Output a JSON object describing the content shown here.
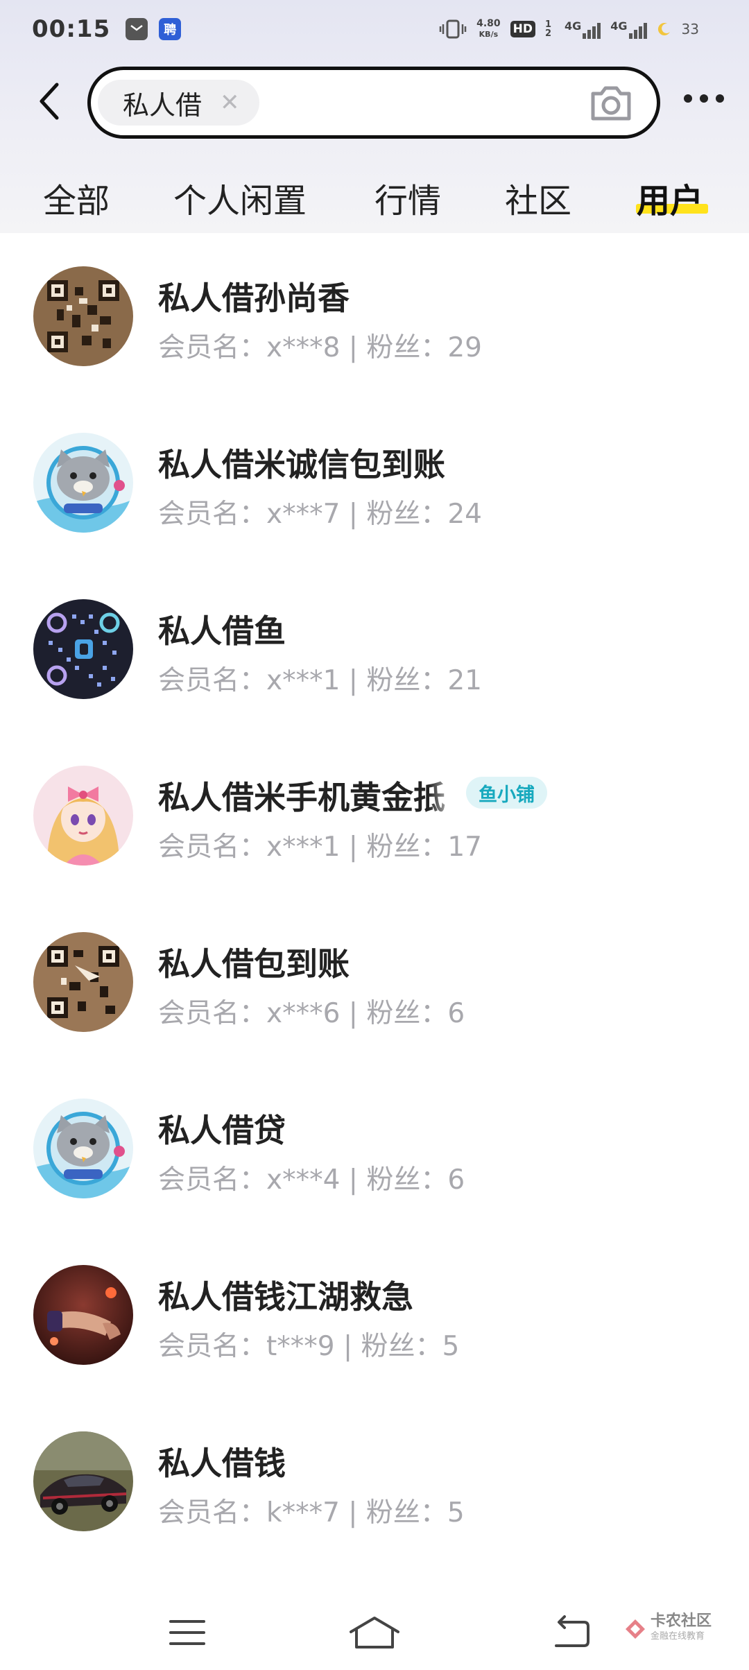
{
  "status_bar": {
    "time": "00:15",
    "app_icons": [
      "mail-icon",
      "job-app-icon"
    ],
    "job_icon_glyph": "聘",
    "net_speed_value": "4.80",
    "net_speed_unit": "KB/s",
    "hd_label": "HD",
    "hd_sub": "1 2",
    "network_1": "4G",
    "network_2": "4G",
    "battery": "33"
  },
  "search": {
    "back_icon": "chevron-left-icon",
    "query": "私人借",
    "clear_icon": "close-icon",
    "camera_icon": "camera-icon",
    "more_icon": "more-dots-icon"
  },
  "tabs": [
    {
      "label": "全部",
      "active": false
    },
    {
      "label": "个人闲置",
      "active": false
    },
    {
      "label": "行情",
      "active": false
    },
    {
      "label": "社区",
      "active": false
    },
    {
      "label": "用户",
      "active": true
    }
  ],
  "accent_color": "#ffe21c",
  "users": [
    {
      "name": "私人借孙尚香",
      "meta": "会员名：x***8 | 粉丝：29",
      "avatar": "qr-code-avatar-warm"
    },
    {
      "name": "私人借米诚信包到账",
      "meta": "会员名：x***7 | 粉丝：24",
      "avatar": "cartoon-cat-avatar"
    },
    {
      "name": "私人借鱼",
      "meta": "会员名：x***1 | 粉丝：21",
      "avatar": "qr-code-avatar-dark"
    },
    {
      "name": "私人借米手机黄金抵",
      "meta": "会员名：x***1 | 粉丝：17",
      "avatar": "anime-girl-avatar",
      "badge": "鱼小铺"
    },
    {
      "name": "私人借包到账",
      "meta": "会员名：x***6 | 粉丝：6",
      "avatar": "qr-code-avatar-warm"
    },
    {
      "name": "私人借贷",
      "meta": "会员名：x***4 | 粉丝：6",
      "avatar": "cartoon-cat-avatar"
    },
    {
      "name": "私人借钱江湖救急",
      "meta": "会员名：t***9 | 粉丝：5",
      "avatar": "photo-hand-avatar"
    },
    {
      "name": "私人借钱",
      "meta": "会员名：k***7 | 粉丝：5",
      "avatar": "sports-car-avatar"
    }
  ],
  "nav": {
    "menu_icon": "menu-icon",
    "home_icon": "home-icon",
    "back_icon": "back-arrow-icon"
  },
  "watermark": {
    "title": "卡农社区",
    "subtitle": "金融在线教育"
  }
}
